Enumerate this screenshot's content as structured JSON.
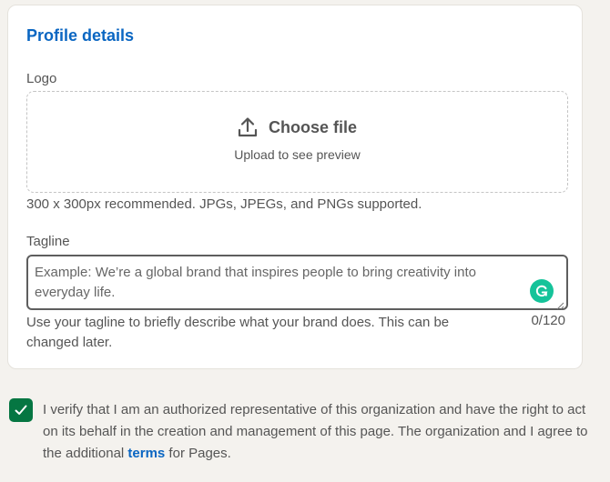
{
  "profile_details": {
    "title": "Profile details",
    "logo": {
      "label": "Logo",
      "choose_file": "Choose file",
      "preview_hint": "Upload to see preview",
      "helper": "300 x 300px recommended. JPGs, JPEGs, and PNGs supported."
    },
    "tagline": {
      "label": "Tagline",
      "value": "",
      "placeholder": "Example: We’re a global brand that inspires people to bring creativity into everyday life.",
      "hint": "Use your tagline to briefly describe what your brand does. This can be changed later.",
      "counter": "0/120"
    }
  },
  "verification": {
    "checked": true,
    "text_before": "I verify that I am an authorized representative of this organization and have the right to act on its behalf in the creation and management of this page. The organization and I agree to the additional ",
    "link_text": "terms",
    "text_after": " for Pages."
  },
  "icons": {
    "upload": "upload-icon",
    "grammarly": "grammarly-icon",
    "checkmark": "checkmark-icon"
  },
  "colors": {
    "accent": "#0a66c2",
    "checkbox": "#057642",
    "grammarly": "#15c39a"
  }
}
